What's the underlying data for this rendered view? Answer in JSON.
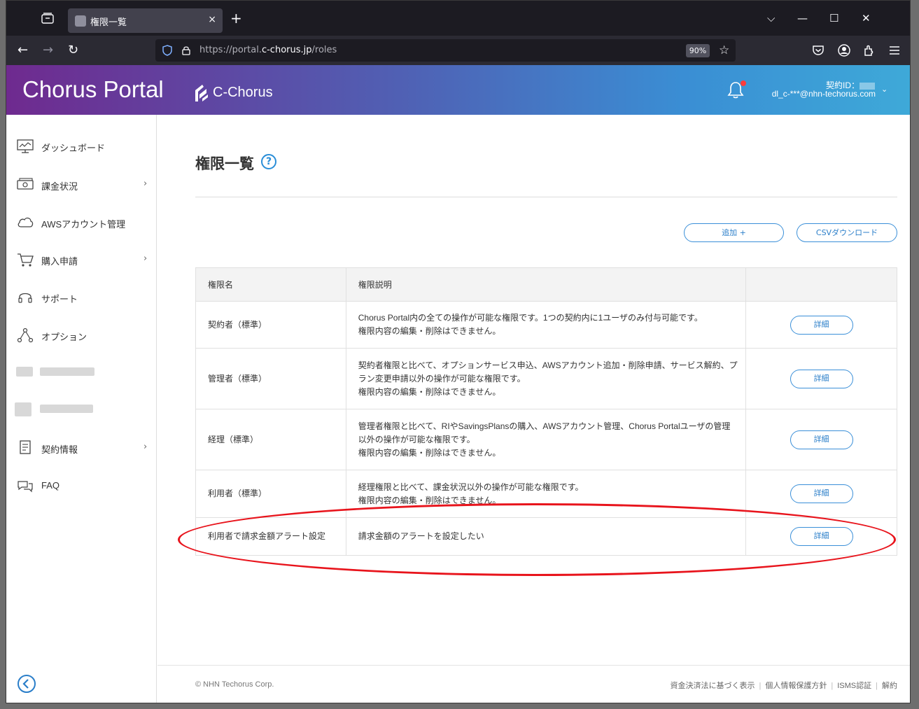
{
  "browser": {
    "tab_title": "権限一覧",
    "tab_close": "×",
    "new_tab": "+",
    "url_scheme": "https://portal.",
    "url_host": "c-chorus.jp",
    "url_path": "/roles",
    "zoom": "90%",
    "window_controls": {
      "list": "⌵",
      "minimize": "—",
      "maximize": "☐",
      "close": "✕"
    },
    "nav": {
      "back": "←",
      "forward": "→",
      "reload": "↻",
      "bookmark": "☆"
    }
  },
  "header": {
    "brand": "Chorus Portal",
    "logo_text": "C-Chorus",
    "contract_id_label": "契約ID：",
    "user_email": "dl_c-***@nhn-techorus.com",
    "user_menu_chevron": "⌄"
  },
  "sidebar": {
    "items": [
      {
        "label": "ダッシュボード",
        "icon": "dashboard-icon",
        "has_submenu": false
      },
      {
        "label": "課金状況",
        "icon": "billing-icon",
        "has_submenu": true
      },
      {
        "label": "AWSアカウント管理",
        "icon": "cloud-icon",
        "has_submenu": false
      },
      {
        "label": "購入申請",
        "icon": "cart-icon",
        "has_submenu": true
      },
      {
        "label": "サポート",
        "icon": "headset-icon",
        "has_submenu": false
      },
      {
        "label": "オプション",
        "icon": "option-icon",
        "has_submenu": false
      },
      {
        "label": "契約情報",
        "icon": "contract-icon",
        "has_submenu": true
      },
      {
        "label": "FAQ",
        "icon": "faq-icon",
        "has_submenu": false
      }
    ],
    "chevron": "›"
  },
  "main": {
    "title": "権限一覧",
    "help": "?",
    "add_button": "追加 +",
    "csv_button": "CSVダウンロード",
    "table": {
      "headers": [
        "権限名",
        "権限説明",
        ""
      ],
      "detail_label": "詳細",
      "rows": [
        {
          "name": "契約者（標準）",
          "desc": [
            "Chorus Portal内の全ての操作が可能な権限です。1つの契約内に1ユーザのみ付与可能です。",
            "権限内容の編集・削除はできません。"
          ]
        },
        {
          "name": "管理者（標準）",
          "desc": [
            "契約者権限と比べて、オプションサービス申込、AWSアカウント追加・削除申請、サービス解約、プ",
            "ラン変更申請以外の操作が可能な権限です。",
            "権限内容の編集・削除はできません。"
          ]
        },
        {
          "name": "経理（標準）",
          "desc": [
            "管理者権限と比べて、RIやSavingsPlansの購入、AWSアカウント管理、Chorus Portalユーザの管理",
            "以外の操作が可能な権限です。",
            "権限内容の編集・削除はできません。"
          ]
        },
        {
          "name": "利用者（標準）",
          "desc": [
            "経理権限と比べて、課金状況以外の操作が可能な権限です。",
            "権限内容の編集・削除はできません。"
          ]
        },
        {
          "name": "利用者で請求金額アラート設定",
          "desc": [
            "請求金額のアラートを設定したい"
          ]
        }
      ]
    }
  },
  "footer": {
    "copyright": "© NHN Techorus Corp.",
    "links": [
      "資金決済法に基づく表示",
      "個人情報保護方針",
      "ISMS認証",
      "解約"
    ]
  },
  "colors": {
    "accent": "#2a7ec9",
    "highlight": "#e8141c",
    "header_start": "#6f2a8f",
    "header_end": "#3ea9d8"
  }
}
